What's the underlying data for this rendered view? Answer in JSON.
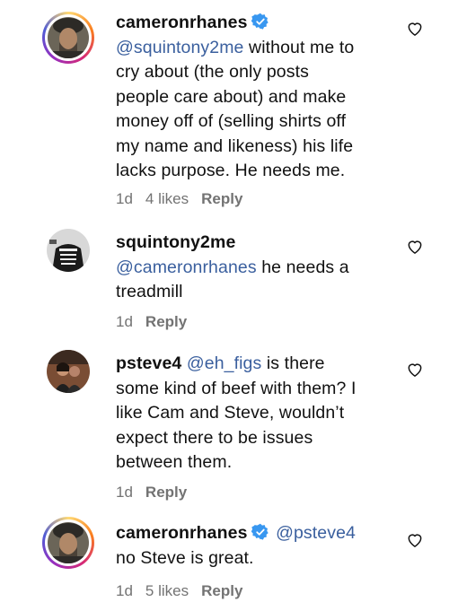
{
  "comments": [
    {
      "username": "cameronrhanes",
      "verified": true,
      "mention": "@squintony2me",
      "lines": [
        " without me to",
        "cry about (the only posts",
        "people care about) and make",
        "money off of (selling shirts off",
        "my name and likeness) his life",
        "lacks purpose. He needs me."
      ],
      "age": "1d",
      "likes": "4 likes",
      "reply": "Reply"
    },
    {
      "username": "squintony2me",
      "verified": false,
      "mention": "@cameronrhanes",
      "lines": [
        " he needs a",
        "treadmill"
      ],
      "age": "1d",
      "reply": "Reply"
    },
    {
      "username": "psteve4",
      "verified": false,
      "mention": "@eh_figs",
      "lines": [
        " is there",
        "some kind of beef with them? I",
        "like Cam and Steve, wouldn’t",
        "expect there to be issues",
        "between them."
      ],
      "age": "1d",
      "reply": "Reply"
    },
    {
      "username": "cameronrhanes",
      "verified": true,
      "mention": "@psteve4",
      "lines": [
        "no Steve is great."
      ],
      "age": "1d",
      "likes": "5 likes",
      "reply": "Reply"
    }
  ],
  "colors": {
    "mention": "#3a5f9e",
    "meta": "#737373",
    "verified": "#3897f0"
  },
  "icons": {
    "like": "heart-outline-icon",
    "verified": "verified-badge-icon"
  }
}
